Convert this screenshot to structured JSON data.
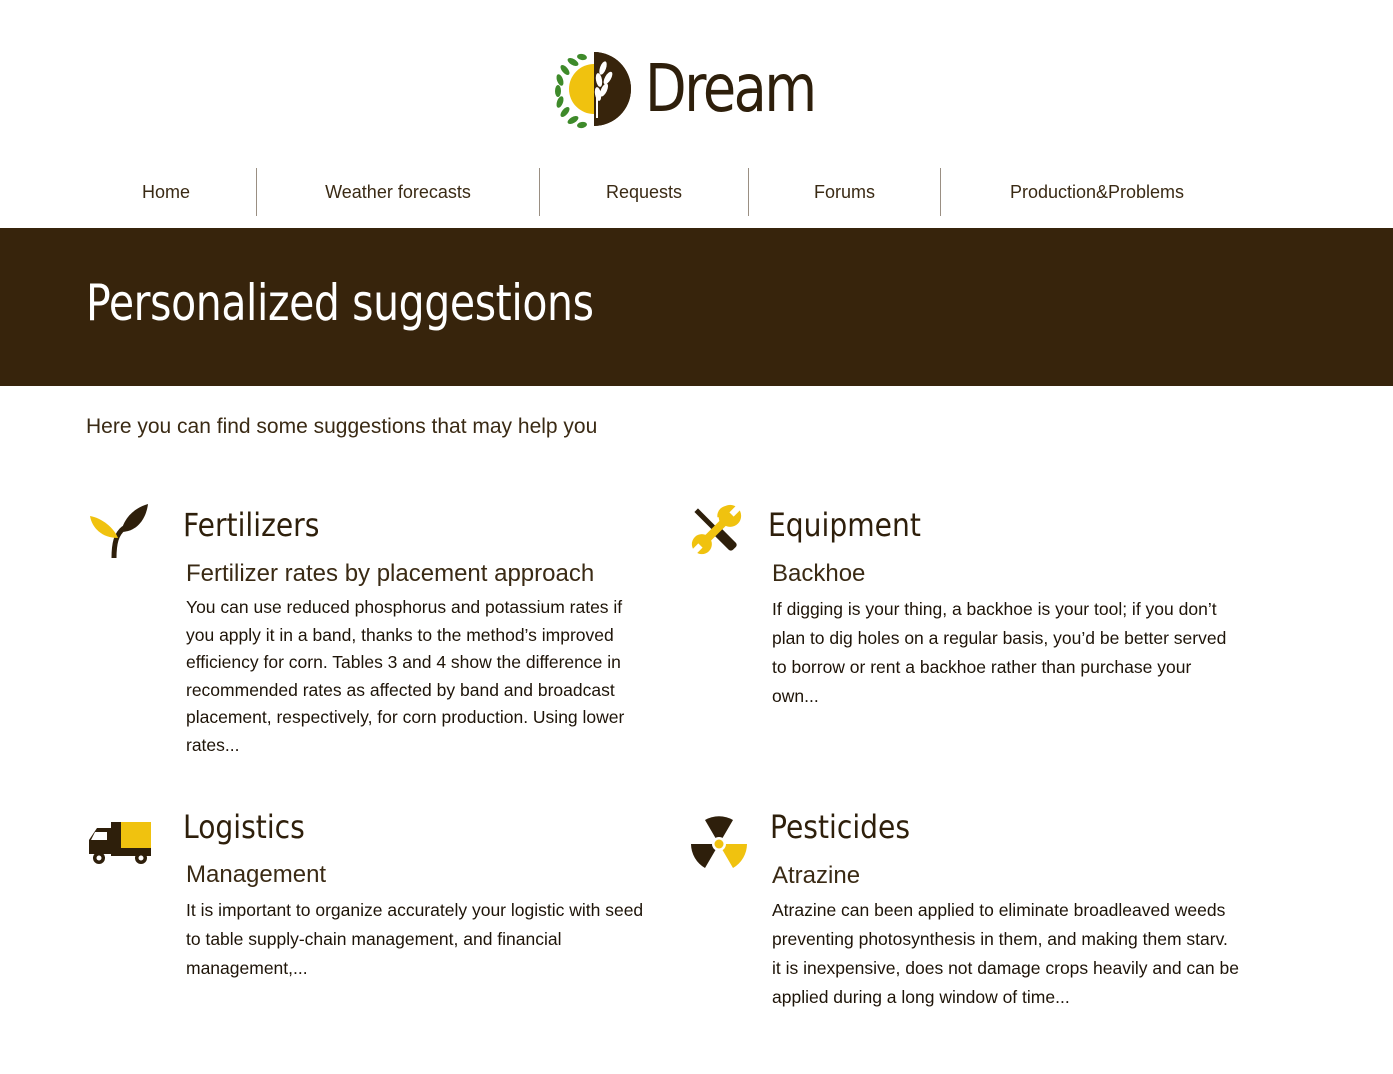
{
  "brand": {
    "name": "Dream",
    "colors": {
      "dark_brown": "#37240c",
      "yellow": "#f0c20f",
      "green": "#3e8a2a"
    }
  },
  "nav": {
    "items": [
      {
        "label": "Home"
      },
      {
        "label": "Weather forecasts"
      },
      {
        "label": "Requests"
      },
      {
        "label": "Forums"
      },
      {
        "label": "Production&Problems"
      }
    ]
  },
  "hero": {
    "title": "Personalized suggestions"
  },
  "intro": "Here you can find some suggestions that may help you",
  "cards": [
    {
      "icon": "plant-sprout-icon",
      "title": "Fertilizers",
      "subtitle": "Fertilizer rates by placement approach",
      "body": "You can use reduced phosphorus and potassium rates if you apply it in a band, thanks to the method’s improved efficiency for corn. Tables 3 and 4 show the difference in recommended rates as affected by band and broadcast placement, respectively, for corn production. Using lower rates..."
    },
    {
      "icon": "wrench-screwdriver-icon",
      "title": "Equipment",
      "subtitle": "Backhoe",
      "body": "If digging is your thing, a backhoe is your tool; if you don’t plan to dig holes on a regular basis, you’d be better served to borrow or rent a backhoe rather than purchase your own..."
    },
    {
      "icon": "truck-icon",
      "title": "Logistics",
      "subtitle": "Management",
      "body": "It is important to organize accurately your logistic with seed to table supply-chain management, and financial management,..."
    },
    {
      "icon": "radiation-hazard-icon",
      "title": "Pesticides",
      "subtitle": "Atrazine",
      "body_lines": [
        "Atrazine can been applied to eliminate broadleaved weeds preventing photosynthesis in them, and making them starv.",
        "it is inexpensive, does not damage crops heavily and can be applied during a long window of time..."
      ]
    }
  ]
}
